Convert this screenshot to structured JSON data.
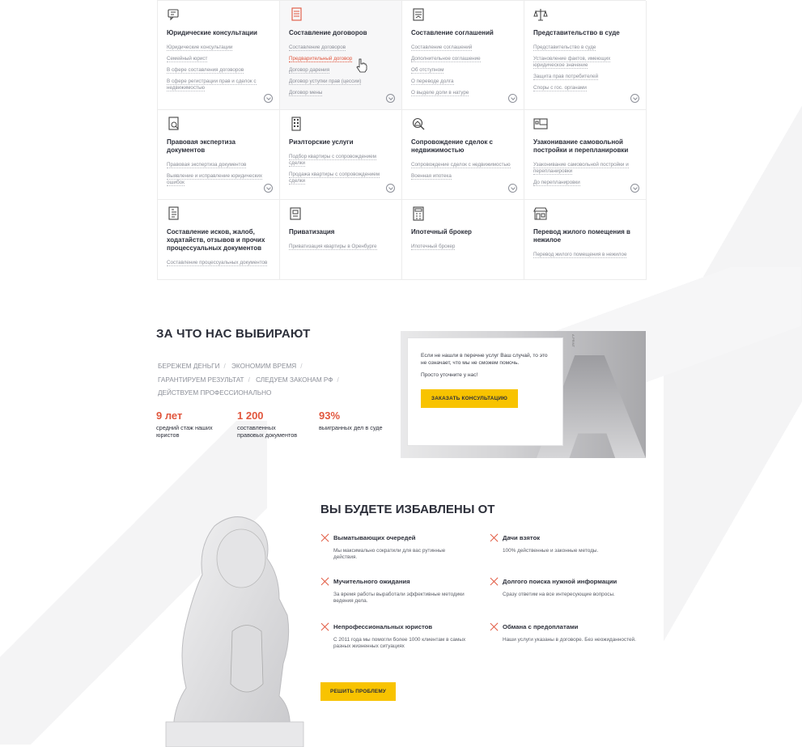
{
  "services": [
    {
      "title": "Юридические консультации",
      "icon": "consultation-icon",
      "links": [
        "Юридические консультации",
        "Семейный юрист",
        "В сфере составления договоров",
        "В сфере регистрации прав и сделок с недвижимостью"
      ],
      "hot": -1,
      "more": true
    },
    {
      "title": "Составление договоров",
      "icon": "contract-icon",
      "links": [
        "Составление договоров",
        "Предварительный договор",
        "Договор дарения",
        "Договор уступки прав (цессии)",
        "Договор мены"
      ],
      "hot": 1,
      "more": true
    },
    {
      "title": "Составление соглашений",
      "icon": "agreement-icon",
      "links": [
        "Составление соглашений",
        "Дополнительное соглашение",
        "Об отступном",
        "О переводе долга",
        "О выделе доли в натуре"
      ],
      "hot": -1,
      "more": true
    },
    {
      "title": "Представительство в суде",
      "icon": "scales-icon",
      "links": [
        "Представительство в суде",
        "Установление фактов, имеющих юридическое значение",
        "Защита прав потребителей",
        "Споры с гос. органами"
      ],
      "hot": -1,
      "more": true
    },
    {
      "title": "Правовая экспертиза документов",
      "icon": "document-search-icon",
      "links": [
        "Правовая экспертиза документов",
        "Выявление и исправление юридических ошибок"
      ],
      "hot": -1,
      "more": true
    },
    {
      "title": "Риэлторские услуги",
      "icon": "building-icon",
      "links": [
        "Подбор квартиры с сопровождением сделки",
        "Продажа квартиры с сопровождением сделки"
      ],
      "hot": -1,
      "more": true
    },
    {
      "title": "Сопровождение сделок с недвижимостью",
      "icon": "house-search-icon",
      "links": [
        "Сопровождение сделок с недвижимостью",
        "Военная ипотека"
      ],
      "hot": -1,
      "more": true
    },
    {
      "title": "Узаконивание самовольной постройки и перепланировки",
      "icon": "floorplan-icon",
      "links": [
        "Узаконивание самовольной постройки и перепланировки",
        "До перепланировки"
      ],
      "hot": -1,
      "more": true
    },
    {
      "title": "Составление исков, жалоб, ходатайств, отзывов и прочих процессуальных документов",
      "icon": "lawsuit-icon",
      "links": [
        "Составление процессуальных документов"
      ],
      "hot": -1,
      "more": false
    },
    {
      "title": "Приватизация",
      "icon": "privatization-icon",
      "links": [
        "Приватизация квартиры в Оренбурге"
      ],
      "hot": -1,
      "more": false
    },
    {
      "title": "Ипотечный брокер",
      "icon": "calculator-icon",
      "links": [
        "Ипотечный брокер"
      ],
      "hot": -1,
      "more": false
    },
    {
      "title": "Перевод жилого помещения в нежилое",
      "icon": "shop-icon",
      "links": [
        "Перевод жилого помещения в нежилое"
      ],
      "hot": -1,
      "more": false
    }
  ],
  "why": {
    "title": "ЗА ЧТО НАС ВЫБИРАЮТ",
    "tags": [
      "БЕРЕЖЕМ ДЕНЬГИ",
      "ЭКОНОМИМ ВРЕМЯ",
      "ГАРАНТИРУЕМ РЕЗУЛЬТАТ",
      "СЛЕДУЕМ ЗАКОНАМ РФ",
      "ДЕЙСТВУЕМ ПРОФЕССИОНАЛЬНО"
    ],
    "stats": [
      {
        "num": "9 лет",
        "cap": "средний стаж нашиx юристов"
      },
      {
        "num": "1 200",
        "cap": "составленных правовых документов"
      },
      {
        "num": "93%",
        "cap": "выигранных дел в суде"
      }
    ]
  },
  "promo": {
    "text": "Если не нашли в перечне услуг Ваш случай, то это не означает, что мы не сможем помочь.",
    "text2": "Просто уточните у нас!",
    "button": "ЗАКАЗАТЬ КОНСУЛЬТАЦИЮ",
    "vertical": "A-PRINT"
  },
  "relief": {
    "title": "ВЫ БУДЕТЕ ИЗБАВЛЕНЫ ОТ",
    "items": [
      {
        "h": "Выматывающих очередей",
        "d": "Мы максимально сократили для вас рутинные действия."
      },
      {
        "h": "Мучительного ожидания",
        "d": "За время работы выработали эффективные методики ведения дела."
      },
      {
        "h": "Непрофессиональных юристов",
        "d": "С 2011 года мы помогли более 1000 клиентам в самых разных жизненных ситуациях"
      },
      {
        "h": "Дачи взяток",
        "d": "100% действенные и законные методы."
      },
      {
        "h": "Долгого поиска нужной информации",
        "d": "Сразу ответим на все интересующие вопросы."
      },
      {
        "h": "Обмана с предоплатами",
        "d": "Наши услуги указаны в договоре. Без неожиданностей."
      }
    ],
    "button": "РЕШИТЬ ПРОБЛЕМУ"
  },
  "colors": {
    "accent": "#e1573e",
    "yellow": "#f8c300",
    "dark": "#2c2f3a"
  }
}
